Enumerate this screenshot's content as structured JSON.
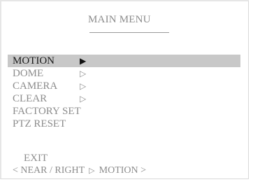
{
  "menu": {
    "title": "MAIN MENU",
    "items": [
      {
        "label": "MOTION",
        "arrow": "▶",
        "selected": true
      },
      {
        "label": "DOME",
        "arrow": "▷",
        "selected": false
      },
      {
        "label": "CAMERA",
        "arrow": "▷",
        "selected": false
      },
      {
        "label": "CLEAR",
        "arrow": "▷",
        "selected": false
      },
      {
        "label": "FACTORY SET",
        "arrow": "",
        "selected": false
      },
      {
        "label": "PTZ RESET",
        "arrow": "",
        "selected": false
      }
    ],
    "exit_label": "EXIT"
  },
  "status_bar": {
    "left": "< NEAR / RIGHT",
    "separator": "▷",
    "right": "MOTION >"
  },
  "colors": {
    "selection_highlight": "#c8c8c8",
    "text": "#8c8c8c",
    "selected_text": "#1a1a1a"
  }
}
